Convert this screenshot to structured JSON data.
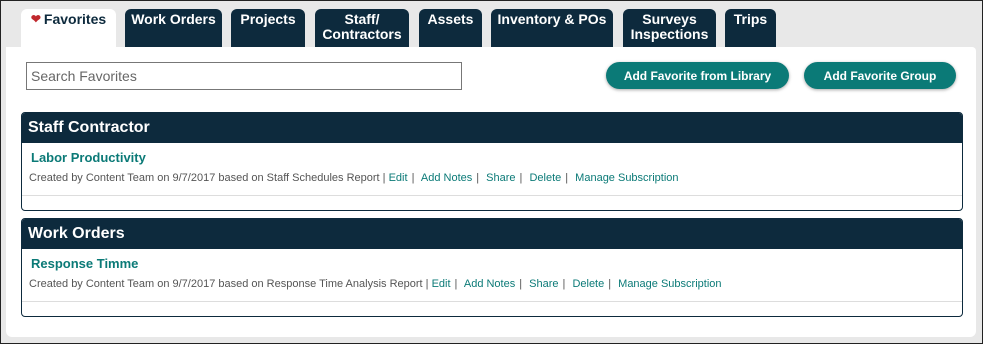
{
  "tabs": [
    {
      "label": "Favorites",
      "active": true
    },
    {
      "label": "Work Orders"
    },
    {
      "label": "Projects"
    },
    {
      "label": "Staff/\nContractors"
    },
    {
      "label": "Assets"
    },
    {
      "label": "Inventory & POs"
    },
    {
      "label": "Surveys\nInspections"
    },
    {
      "label": "Trips"
    }
  ],
  "search": {
    "placeholder": "Search Favorites"
  },
  "buttons": {
    "add_from_library": "Add Favorite from Library",
    "add_group": "Add Favorite Group"
  },
  "groups": [
    {
      "title": "Staff Contractor",
      "item": {
        "title": "Labor Productivity",
        "meta": "Created by Content Team on 9/7/2017 based on Staff Schedules Report |",
        "actions": [
          "Edit",
          "Add Notes",
          "Share",
          "Delete",
          "Manage Subscription"
        ]
      }
    },
    {
      "title": "Work Orders",
      "item": {
        "title": "Response Timme",
        "meta": "Created by Content Team on 9/7/2017 based on Response Time Analysis Report |",
        "actions": [
          "Edit",
          "Add Notes",
          "Share",
          "Delete",
          "Manage Subscription"
        ]
      }
    }
  ],
  "colors": {
    "navy": "#0d2a3d",
    "teal": "#0b7a77",
    "heart": "#c0282d"
  }
}
